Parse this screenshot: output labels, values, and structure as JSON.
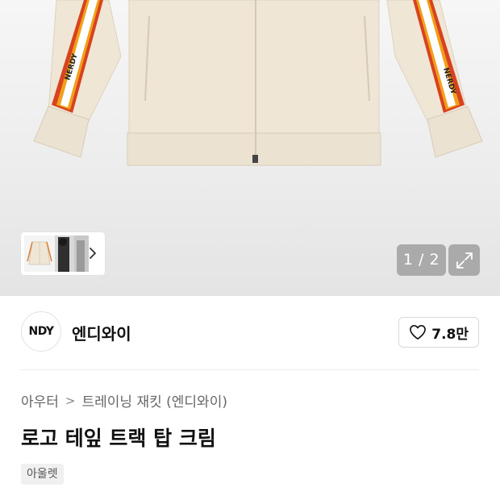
{
  "gallery": {
    "page_indicator": "1 / 2",
    "jacket_text_left": "NERDY",
    "jacket_text_right": "NERDY"
  },
  "brand": {
    "logo_text": "NDY",
    "name": "엔디와이",
    "like_count": "7.8만"
  },
  "breadcrumb": {
    "category": "아우터",
    "separator": ">",
    "subcategory": "트레이닝 재킷 (엔디와이)"
  },
  "product": {
    "title": "로고 테잎 트랙 탑 크림",
    "tag": "아울렛"
  },
  "colors": {
    "jacket": "#efe6d6",
    "stripe_red": "#d8421f",
    "stripe_orange": "#f0a01a",
    "overlay": "#969696"
  }
}
